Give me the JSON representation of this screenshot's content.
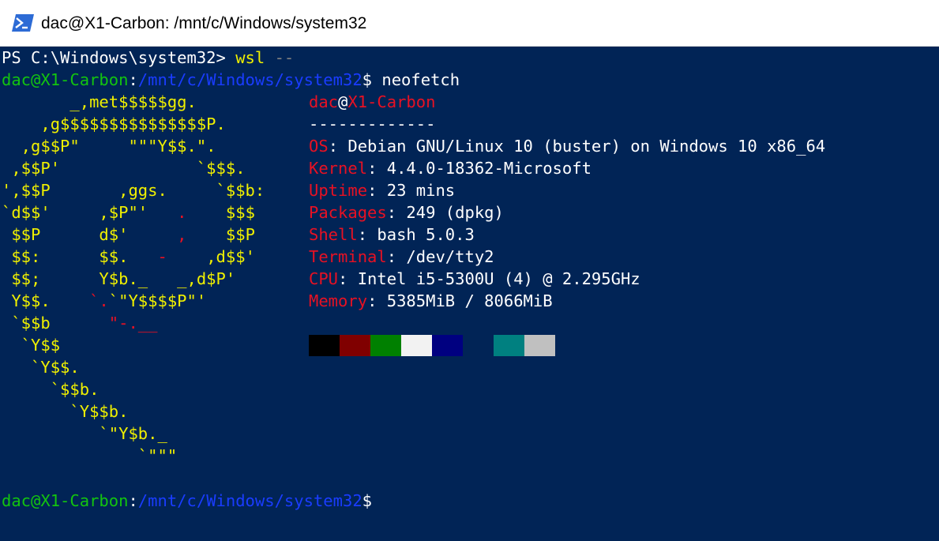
{
  "window": {
    "title": "dac@X1-Carbon: /mnt/c/Windows/system32",
    "icon": "powershell-icon"
  },
  "terminal": {
    "background": "#012456",
    "ps_prompt": "PS C:\\Windows\\system32> ",
    "ps_command": "wsl",
    "ps_args": " --",
    "bash_user": "dac@X1-Carbon",
    "bash_colon": ":",
    "bash_path": "/mnt/c/Windows/system32",
    "bash_dollar": "$",
    "bash_command": " neofetch",
    "logo_lines": [
      {
        "y1": "       _,met$$$$$gg.",
        "r": "",
        "y2": ""
      },
      {
        "y1": "    ,g$$$$$$$$$$$$$$$P.",
        "r": "",
        "y2": ""
      },
      {
        "y1": "  ,g$$P\"     \"\"\"Y$$.\".",
        "r": "",
        "y2": ""
      },
      {
        "y1": " ,$$P'              `$$$.",
        "r": "",
        "y2": ""
      },
      {
        "y1": "',$$P       ,ggs.     `$$b:",
        "r": "",
        "y2": ""
      },
      {
        "y1": "`d$$'     ,$P\"'   ",
        "r": ".",
        "y2": "    $$$"
      },
      {
        "y1": " $$P      d$'     ",
        "r": ",",
        "y2": "    $$P"
      },
      {
        "y1": " $$:      $$.   ",
        "r": "-",
        "y2": "    ,d$$'"
      },
      {
        "y1": " $$;      Y$b._   _,d$P'",
        "r": "",
        "y2": ""
      },
      {
        "y1": " Y$$.    ",
        "r": "`.",
        "y2": "`\"Y$$$$P\"'"
      },
      {
        "y1": " `$$b      ",
        "r": "\"-.__",
        "y2": ""
      },
      {
        "y1": "  `Y$$",
        "r": "",
        "y2": ""
      },
      {
        "y1": "   `Y$$.",
        "r": "",
        "y2": ""
      },
      {
        "y1": "     `$$b.",
        "r": "",
        "y2": ""
      },
      {
        "y1": "       `Y$$b.",
        "r": "",
        "y2": ""
      },
      {
        "y1": "          `\"Y$b._",
        "r": "",
        "y2": ""
      },
      {
        "y1": "              `\"\"\"",
        "r": "",
        "y2": ""
      }
    ],
    "info_header": {
      "user": "dac",
      "at": "@",
      "host": "X1-Carbon",
      "separator": "-------------"
    },
    "info": [
      {
        "key": "OS",
        "value": ": Debian GNU/Linux 10 (buster) on Windows 10 x86_64"
      },
      {
        "key": "Kernel",
        "value": ": 4.4.0-18362-Microsoft"
      },
      {
        "key": "Uptime",
        "value": ": 23 mins"
      },
      {
        "key": "Packages",
        "value": ": 249 (dpkg)"
      },
      {
        "key": "Shell",
        "value": ": bash 5.0.3"
      },
      {
        "key": "Terminal",
        "value": ": /dev/tty2"
      },
      {
        "key": "CPU",
        "value": ": Intel i5-5300U (4) @ 2.295GHz"
      },
      {
        "key": "Memory",
        "value": ": 5385MiB / 8066MiB"
      }
    ],
    "palette": [
      "#000000",
      "#800000",
      "#008000",
      "#f2f2f2",
      "#000080",
      "#012456",
      "#008080",
      "#c0c0c0"
    ]
  }
}
